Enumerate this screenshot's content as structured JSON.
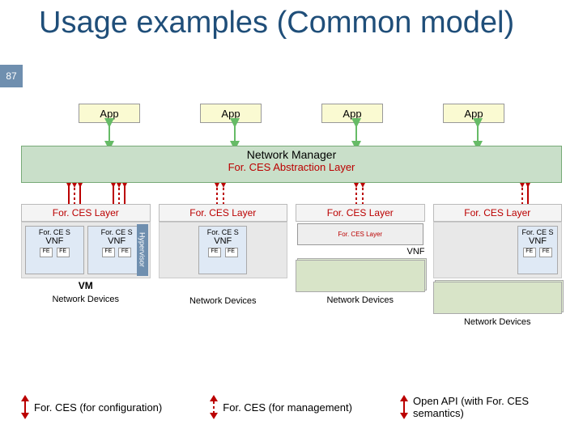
{
  "page_number": "87",
  "title": "Usage examples (Common model)",
  "apps": [
    "App",
    "App",
    "App",
    "App"
  ],
  "network_manager": {
    "title": "Network Manager",
    "subtitle": "For. CES Abstraction Layer"
  },
  "columns": [
    {
      "layer": "For. CES Layer",
      "vnfs": [
        {
          "prefix": "For. CE S",
          "label": "VNF",
          "fes": [
            "FE",
            "FE"
          ]
        },
        {
          "prefix": "For. CE S",
          "label": "VNF",
          "fes": [
            "FE",
            "FE"
          ]
        }
      ],
      "hypervisor": "Hypervisor",
      "vm": "VM",
      "nd": "Network Devices"
    },
    {
      "layer": "For. CES Layer",
      "vnfs": [
        {
          "prefix": "For. CE S",
          "label": "VNF",
          "fes": [
            "FE",
            "FE"
          ]
        }
      ],
      "nd": "Network Devices"
    },
    {
      "layer": "For. CES Layer",
      "vnf_side": "VNF",
      "mini_layer": "For. CES Layer",
      "nd": "Network Devices"
    },
    {
      "layer": "For. CES Layer",
      "vnfs": [
        {
          "prefix": "For. CE S",
          "label": "VNF",
          "fes": [
            "FE",
            "FE"
          ]
        }
      ],
      "nd": "Network Devices"
    }
  ],
  "legend": [
    "For. CES (for configuration)",
    "For. CES (for management)",
    "Open API (with For. CES semantics)"
  ]
}
